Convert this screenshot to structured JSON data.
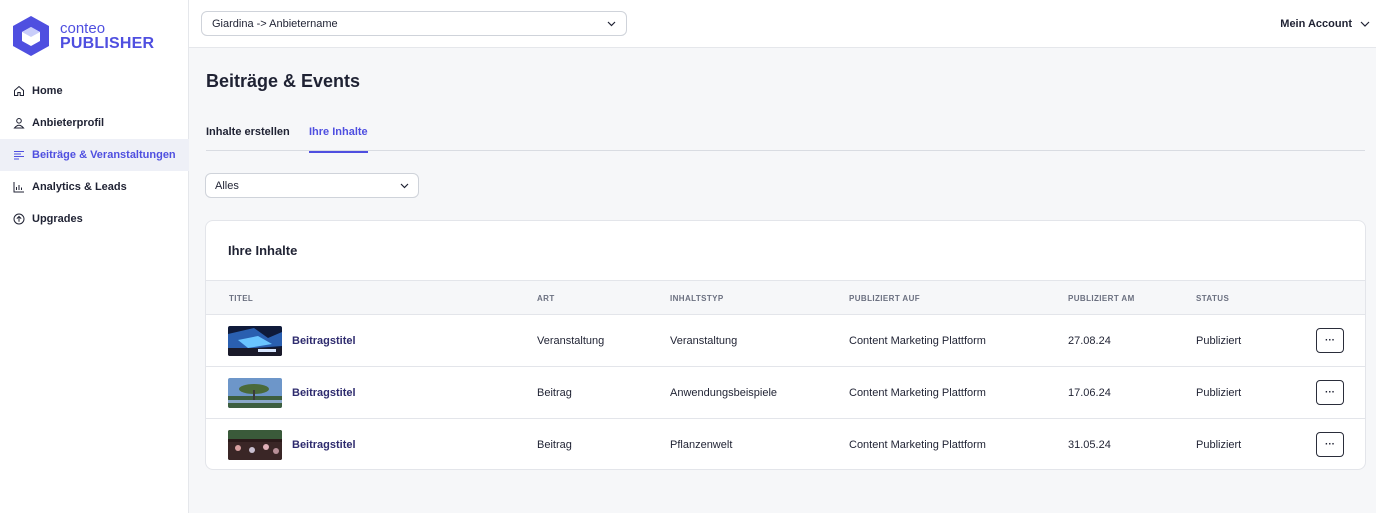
{
  "brand": {
    "line1": "conteo",
    "line2": "PUBLISHER",
    "color": "#4f4fe0"
  },
  "sidebar": {
    "items": [
      {
        "label": "Home",
        "icon": "home-icon"
      },
      {
        "label": "Anbieterprofil",
        "icon": "user-icon"
      },
      {
        "label": "Beiträge & Veranstaltungen",
        "icon": "list-icon",
        "active": true
      },
      {
        "label": "Analytics & Leads",
        "icon": "chart-icon"
      },
      {
        "label": "Upgrades",
        "icon": "arrow-up-circle-icon"
      }
    ]
  },
  "topbar": {
    "provider_select": "Giardina -> Anbietername",
    "account_label": "Mein Account"
  },
  "page": {
    "title": "Beiträge & Events",
    "tabs": [
      {
        "label": "Inhalte erstellen"
      },
      {
        "label": "Ihre Inhalte",
        "active": true
      }
    ],
    "filter_value": "Alles"
  },
  "table": {
    "card_title": "Ihre Inhalte",
    "headers": [
      "TITEL",
      "ART",
      "INHALTSTYP",
      "PUBLIZIERT AUF",
      "PUBLIZIERT AM",
      "STATUS"
    ],
    "rows": [
      {
        "title": "Beitragstitel",
        "art": "Veranstaltung",
        "typ": "Veranstaltung",
        "platform": "Content Marketing Plattform",
        "date": "27.08.24",
        "status": "Publiziert",
        "more": "···"
      },
      {
        "title": "Beitragstitel",
        "art": "Beitrag",
        "typ": "Anwendungsbeispiele",
        "platform": "Content Marketing Plattform",
        "date": "17.06.24",
        "status": "Publiziert",
        "more": "···"
      },
      {
        "title": "Beitragstitel",
        "art": "Beitrag",
        "typ": "Pflanzenwelt",
        "platform": "Content Marketing Plattform",
        "date": "31.05.24",
        "status": "Publiziert",
        "more": "···"
      }
    ]
  },
  "colors": {
    "accent": "#4f4fe0",
    "title_link": "#2e2b6e",
    "background": "#f6f7f9"
  }
}
